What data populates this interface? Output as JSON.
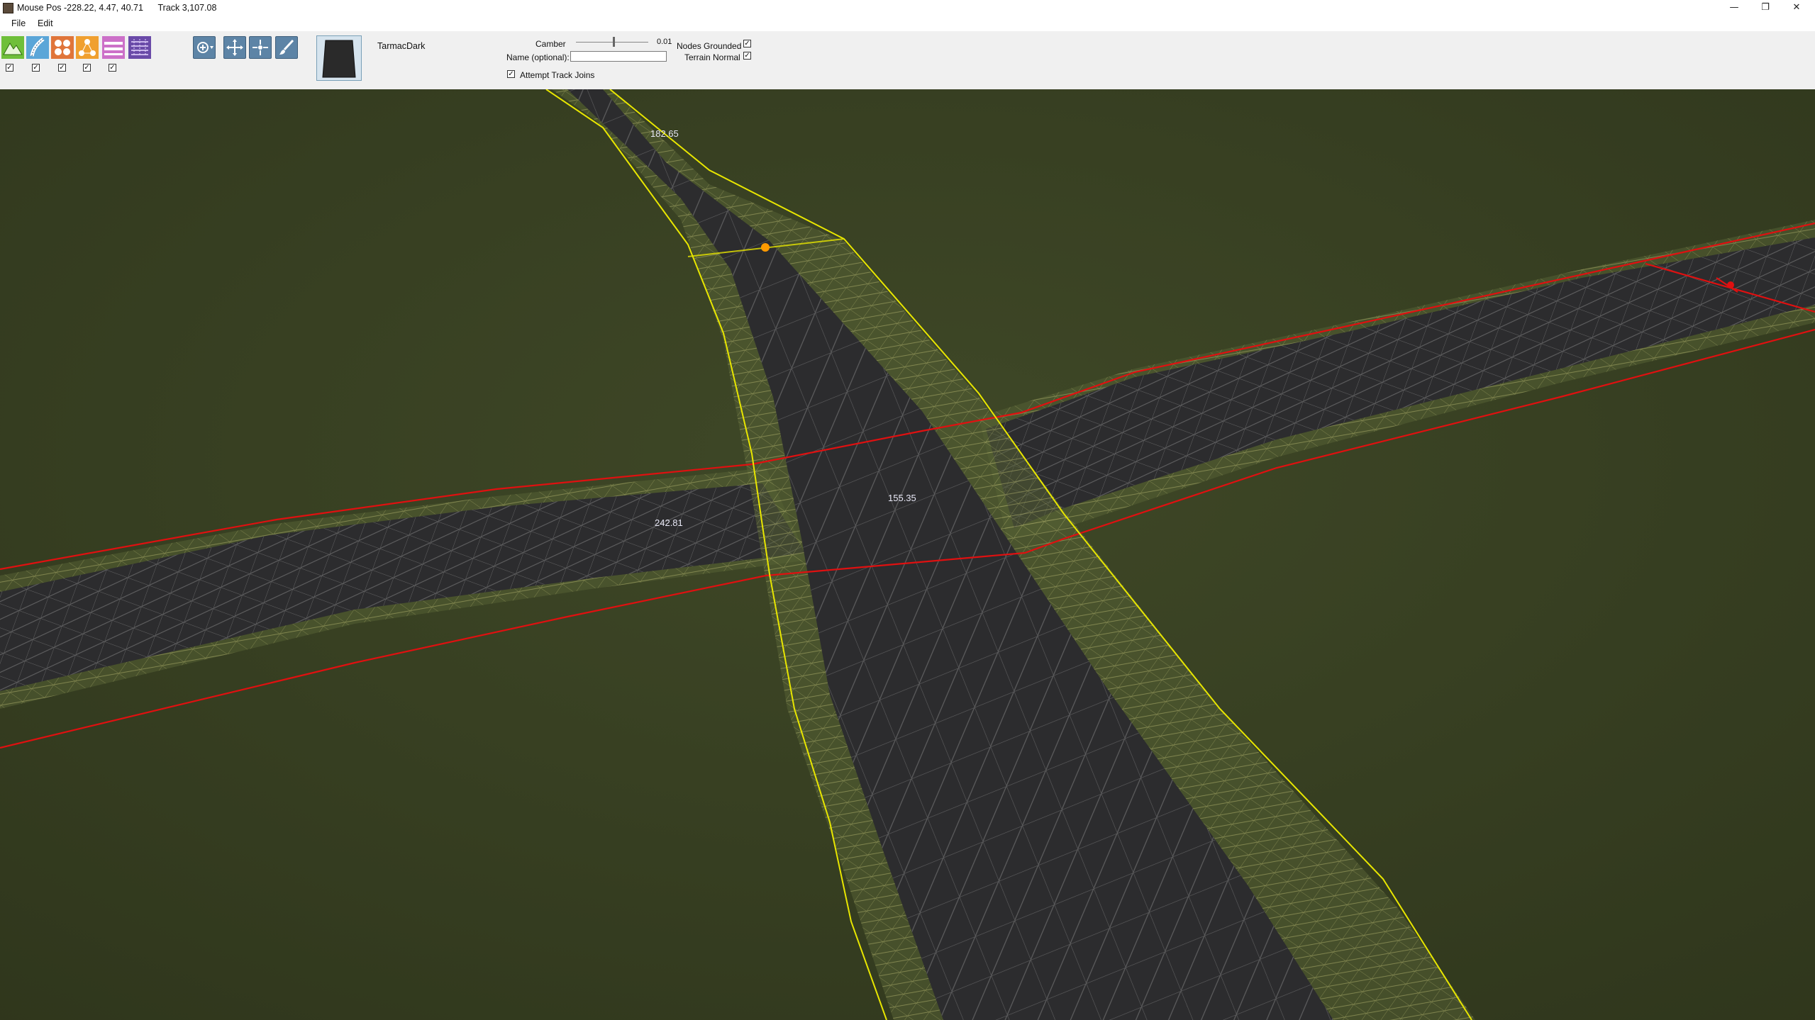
{
  "window": {
    "title": "Mouse Pos -228.22, 4.47, 40.71      Track 3,107.08",
    "minimize_glyph": "—",
    "restore_glyph": "❐",
    "close_glyph": "✕"
  },
  "menu": {
    "items": [
      "File",
      "Edit"
    ]
  },
  "toolbar": {
    "layer_tools": [
      {
        "icon": "terrain-icon",
        "color": "#6fbf3a",
        "checked": true
      },
      {
        "icon": "road-icon",
        "color": "#5ba6d8",
        "checked": true
      },
      {
        "icon": "objects-icon",
        "color": "#e0753a",
        "checked": true
      },
      {
        "icon": "nodes-icon",
        "color": "#f0a030",
        "checked": true
      },
      {
        "icon": "fence-icon",
        "color": "#cc70c8",
        "checked": true
      },
      {
        "icon": "texture-icon",
        "color": "#6a4aa8"
      }
    ],
    "edit_tools": [
      "add-node-icon",
      "move-node-icon",
      "split-node-icon",
      "paint-brush-icon"
    ],
    "material": {
      "name": "TarmacDark"
    },
    "camber": {
      "label": "Camber",
      "value": "0.01",
      "level": 0.52
    },
    "name_field": {
      "label": "Name (optional):",
      "value": ""
    },
    "options": {
      "nodes_grounded": {
        "label": "Nodes Grounded",
        "checked": true
      },
      "terrain_normal": {
        "label": "Terrain Normal",
        "checked": true
      },
      "attempt_track_joins": {
        "label": "Attempt Track Joins",
        "checked": true
      }
    }
  },
  "viewport": {
    "measurements": [
      "182.65",
      "155.35",
      "242.81"
    ],
    "colors": {
      "grass": "#3a4224",
      "tarmac": "#2c2c2e",
      "selected_outline": "#e8e600",
      "other_outline": "#e01010",
      "node": "#ff9a00"
    }
  }
}
